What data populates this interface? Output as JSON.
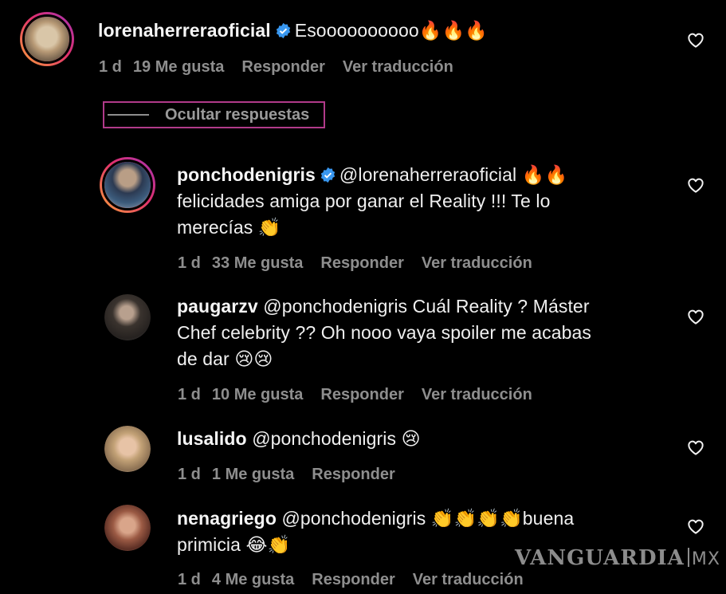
{
  "comments": [
    {
      "username": "lorenaherreraoficial",
      "verified": true,
      "text": "Esoooooooooo",
      "emoji": "🔥🔥🔥",
      "meta": {
        "time": "1 d",
        "likes": "19 Me gusta",
        "reply": "Responder",
        "translate": "Ver traducción"
      }
    },
    {
      "username": "ponchodenigris",
      "verified": true,
      "mention": "@lorenaherreraoficial",
      "emoji_after_mention": "🔥🔥",
      "text_line2": "felicidades amiga por ganar el Reality !!! Te lo",
      "text_line3": "merecías",
      "emoji_line3": "👏",
      "meta": {
        "time": "1 d",
        "likes": "33 Me gusta",
        "reply": "Responder",
        "translate": "Ver traducción"
      }
    },
    {
      "username": "paugarzv",
      "text_line1": "@ponchodenigris Cuál Reality ? Máster",
      "text_line2": "Chef celebrity ?? Oh nooo vaya spoiler me acabas",
      "text_line3": "de dar",
      "emoji_line3": "😢😢",
      "meta": {
        "time": "1 d",
        "likes": "10 Me gusta",
        "reply": "Responder",
        "translate": "Ver traducción"
      }
    },
    {
      "username": "lusalido",
      "text": "@ponchodenigris",
      "emoji": "😢",
      "meta": {
        "time": "1 d",
        "likes": "1 Me gusta",
        "reply": "Responder"
      }
    },
    {
      "username": "nenagriego",
      "text": "@ponchodenigris",
      "emoji": "👏👏👏👏",
      "text_after_emoji": "buena",
      "text_line2": "primicia",
      "emoji_line2": "😂👏",
      "meta": {
        "time": "1 d",
        "likes": "4 Me gusta",
        "reply": "Responder",
        "translate": "Ver traducción"
      }
    }
  ],
  "hide_replies_label": "Ocultar respuestas",
  "watermark": {
    "brand": "VANGUARDIA",
    "suffix": "MX"
  },
  "icons": {
    "like": "heart-outline-icon",
    "verified": "verified-badge-icon"
  },
  "colors": {
    "background": "#000000",
    "verified": "#3897f0",
    "meta": "#8e8e8e",
    "highlight_border": "#b13a8a"
  }
}
